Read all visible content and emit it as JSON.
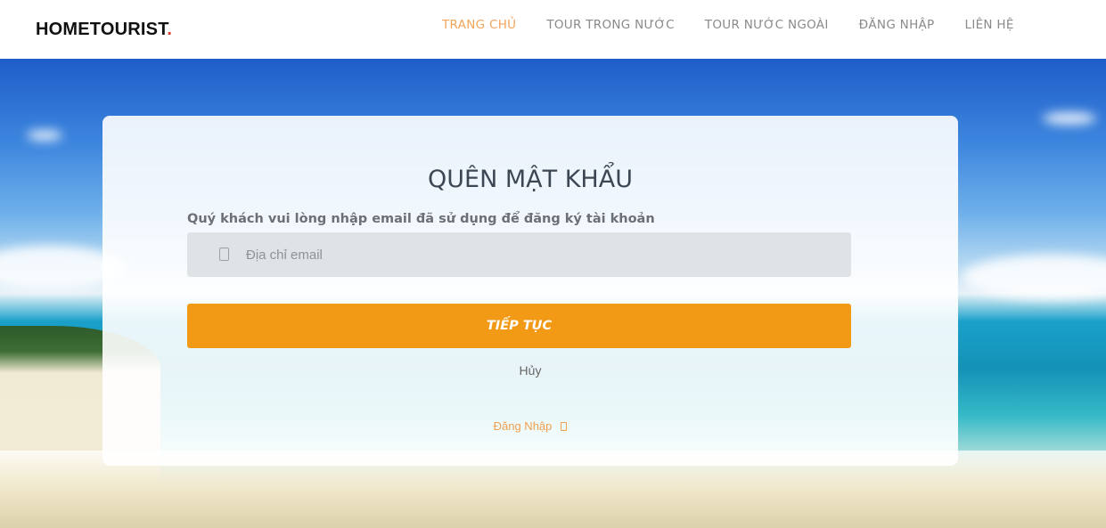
{
  "header": {
    "logo_text": "HOMETOURIST",
    "logo_dot": ".",
    "nav": [
      {
        "label": "TRANG CHỦ",
        "active": true
      },
      {
        "label": "TOUR TRONG NƯỚC",
        "active": false
      },
      {
        "label": "TOUR NƯỚC NGOÀI",
        "active": false
      },
      {
        "label": "ĐĂNG NHẬP",
        "active": false
      },
      {
        "label": "LIÊN HỆ",
        "active": false
      }
    ]
  },
  "form": {
    "title": "QUÊN MẬT KHẨU",
    "instruction": "Quý khách vui lòng nhập email đã sử dụng để đăng ký tài khoản",
    "email_placeholder": "Địa chỉ email",
    "email_value": "",
    "email_icon": "envelope-icon",
    "continue_label": "TIẾP TỤC",
    "cancel_label": "Hủy",
    "login_label": "Đăng Nhập",
    "login_icon": "arrow-right-icon"
  },
  "colors": {
    "accent": "#f29a16",
    "nav_active": "#f3a45b",
    "logo_dot": "#e0402a"
  }
}
